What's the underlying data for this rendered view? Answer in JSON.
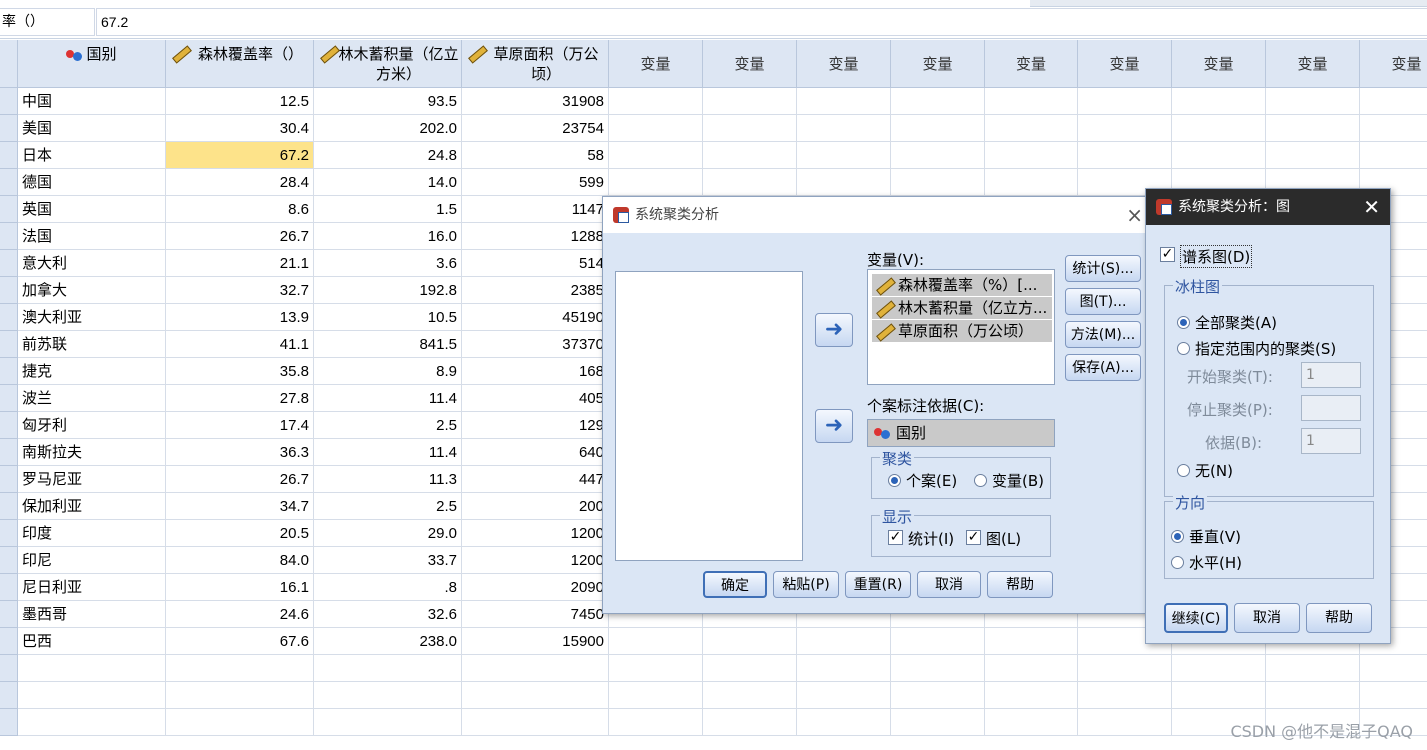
{
  "cellbar": {
    "name": "率（）",
    "value": "67.2"
  },
  "columns": [
    {
      "label": "国别",
      "type": "nominal"
    },
    {
      "label": "森林覆盖率（）",
      "type": "scale"
    },
    {
      "label": "林木蓄积量（亿立方米）",
      "type": "scale"
    },
    {
      "label": "草原面积（万公顷）",
      "type": "scale"
    }
  ],
  "empty_col_label": "变量",
  "rows": [
    [
      "中国",
      "12.5",
      "93.5",
      "31908"
    ],
    [
      "美国",
      "30.4",
      "202.0",
      "23754"
    ],
    [
      "日本",
      "67.2",
      "24.8",
      "58"
    ],
    [
      "德国",
      "28.4",
      "14.0",
      "599"
    ],
    [
      "英国",
      "8.6",
      "1.5",
      "1147"
    ],
    [
      "法国",
      "26.7",
      "16.0",
      "1288"
    ],
    [
      "意大利",
      "21.1",
      "3.6",
      "514"
    ],
    [
      "加拿大",
      "32.7",
      "192.8",
      "2385"
    ],
    [
      "澳大利亚",
      "13.9",
      "10.5",
      "45190"
    ],
    [
      "前苏联",
      "41.1",
      "841.5",
      "37370"
    ],
    [
      "捷克",
      "35.8",
      "8.9",
      "168"
    ],
    [
      "波兰",
      "27.8",
      "11.4",
      "405"
    ],
    [
      "匈牙利",
      "17.4",
      "2.5",
      "129"
    ],
    [
      "南斯拉夫",
      "36.3",
      "11.4",
      "640"
    ],
    [
      "罗马尼亚",
      "26.7",
      "11.3",
      "447"
    ],
    [
      "保加利亚",
      "34.7",
      "2.5",
      "200"
    ],
    [
      "印度",
      "20.5",
      "29.0",
      "1200"
    ],
    [
      "印尼",
      "84.0",
      "33.7",
      "1200"
    ],
    [
      "尼日利亚",
      "16.1",
      ".8",
      "2090"
    ],
    [
      "墨西哥",
      "24.6",
      "32.6",
      "7450"
    ],
    [
      "巴西",
      "67.6",
      "238.0",
      "15900"
    ]
  ],
  "main_dialog": {
    "title": "系统聚类分析",
    "variables_label": "变量(V):",
    "variables": [
      "森林覆盖率（%）[...",
      "林木蓄积量（亿立方...",
      "草原面积（万公顷）"
    ],
    "label_cases_label": "个案标注依据(C):",
    "label_case_var": "国别",
    "cluster_group": "聚类",
    "cluster_cases": "个案(E)",
    "cluster_vars": "变量(B)",
    "display_group": "显示",
    "display_stats": "统计(I)",
    "display_plots": "图(L)",
    "side_buttons": [
      "统计(S)...",
      "图(T)...",
      "方法(M)...",
      "保存(A)..."
    ],
    "bottom_buttons": [
      "确定",
      "粘贴(P)",
      "重置(R)",
      "取消",
      "帮助"
    ]
  },
  "plots_dialog": {
    "title": "系统聚类分析：图",
    "dendrogram": "谱系图(D)",
    "icicle_group": "冰柱图",
    "all_clusters": "全部聚类(A)",
    "range_clusters": "指定范围内的聚类(S)",
    "start_label": "开始聚类(T):",
    "start_value": "1",
    "stop_label": "停止聚类(P):",
    "stop_value": "",
    "by_label": "依据(B):",
    "by_value": "1",
    "none": "无(N)",
    "orientation_group": "方向",
    "vertical": "垂直(V)",
    "horizontal": "水平(H)",
    "buttons": [
      "继续(C)",
      "取消",
      "帮助"
    ]
  },
  "watermark": "CSDN @他不是混子QAQ"
}
